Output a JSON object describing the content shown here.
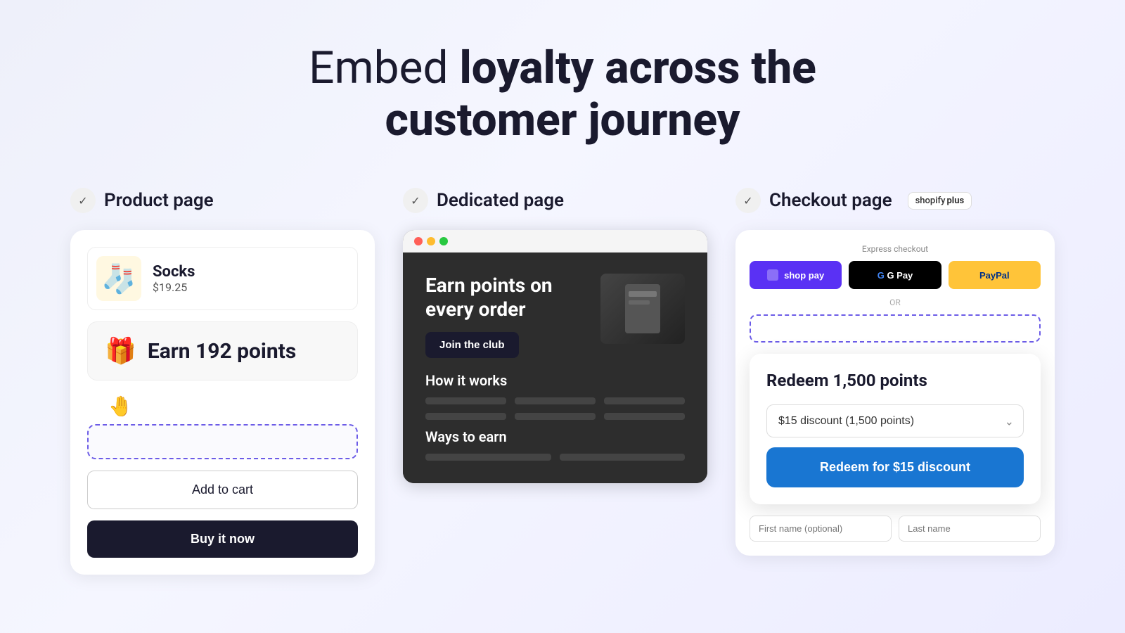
{
  "headline": {
    "part1": "Embed ",
    "part2": "loyalty across the",
    "part3": "customer journey"
  },
  "columns": {
    "product": {
      "label": "Product page",
      "checkmark": "✓",
      "product_name": "Socks",
      "product_price": "$19.25",
      "product_emoji": "🧦",
      "earn_points_text": "Earn 192 points",
      "add_to_cart": "Add to cart",
      "buy_it_now": "Buy it now"
    },
    "dedicated": {
      "label": "Dedicated page",
      "checkmark": "✓",
      "hero_title": "Earn points on every order",
      "join_btn": "Join the club",
      "how_it_works": "How it works",
      "ways_to_earn": "Ways to earn"
    },
    "checkout": {
      "label": "Checkout page",
      "checkmark": "✓",
      "shopify_plus": "shopify plus",
      "express_checkout": "Express checkout",
      "shop_pay": "shop pay",
      "gpay": "G Pay",
      "paypal": "PayPal",
      "or_text": "OR",
      "redeem_title": "Redeem 1,500 points",
      "discount_option": "$15 discount (1,500 points)",
      "redeem_btn": "Redeem for $15 discount",
      "first_name_placeholder": "First name (optional)",
      "last_name_placeholder": "Last name"
    }
  }
}
